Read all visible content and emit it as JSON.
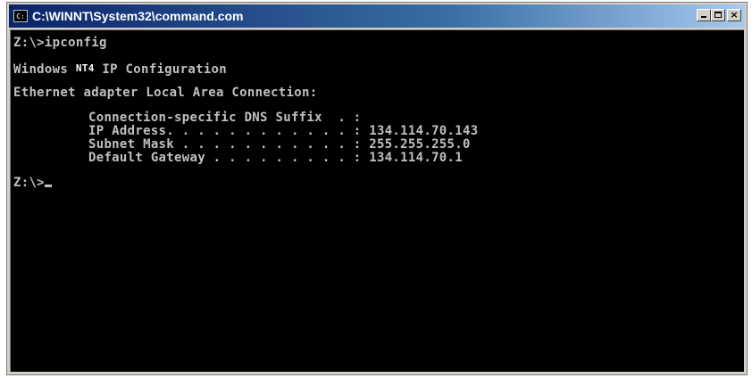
{
  "window": {
    "title": "C:\\WINNT\\System32\\command.com",
    "icon": "ms-dos-console-icon",
    "controls": {
      "minimize": "minimize-icon",
      "maximize": "maximize-icon",
      "close": "×"
    }
  },
  "console": {
    "prompt1": "Z:\\>ipconfig",
    "heading_prefix": "Windows ",
    "heading_nt": "NT4",
    "heading_suffix": " IP Configuration",
    "adapter": "Ethernet adapter Local Area Connection:",
    "rows": [
      {
        "label": "Connection-specific DNS Suffix  . :",
        "value": ""
      },
      {
        "label": "IP Address. . . . . . . . . . . . :",
        "value": " 134.114.70.143"
      },
      {
        "label": "Subnet Mask . . . . . . . . . . . :",
        "value": " 255.255.255.0"
      },
      {
        "label": "Default Gateway . . . . . . . . . :",
        "value": " 134.114.70.1"
      }
    ],
    "prompt2": "Z:\\>"
  },
  "colors": {
    "console_bg": "#000000",
    "console_text": "#c0c0c0",
    "titlebar_start": "#0a246a",
    "titlebar_end": "#a6caf0"
  }
}
